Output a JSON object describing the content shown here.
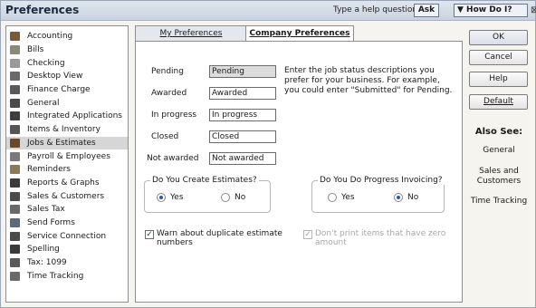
{
  "window": {
    "title": "Preferences"
  },
  "helpbar": {
    "question": "Type a help question",
    "ask": "Ask",
    "howdoi": "▼ How Do I?",
    "close": "⊠"
  },
  "sidebar": {
    "items": [
      {
        "label": "Accounting",
        "icon": "accounting-icon",
        "color": "#7a5a3a"
      },
      {
        "label": "Bills",
        "icon": "bills-icon",
        "color": "#8a8a7a"
      },
      {
        "label": "Checking",
        "icon": "checking-icon",
        "color": "#9a9a9a"
      },
      {
        "label": "Desktop View",
        "icon": "desktop-view-icon",
        "color": "#6a6a6a"
      },
      {
        "label": "Finance Charge",
        "icon": "finance-charge-icon",
        "color": "#5a5a5a"
      },
      {
        "label": "General",
        "icon": "general-icon",
        "color": "#4a4a4a"
      },
      {
        "label": "Integrated Applications",
        "icon": "integrated-applications-icon",
        "color": "#3e3e3e"
      },
      {
        "label": "Items & Inventory",
        "icon": "items-inventory-icon",
        "color": "#555555"
      },
      {
        "label": "Jobs & Estimates",
        "icon": "jobs-estimates-icon",
        "color": "#6a4a2a",
        "selected": true
      },
      {
        "label": "Payroll & Employees",
        "icon": "payroll-employees-icon",
        "color": "#7a7a7a"
      },
      {
        "label": "Reminders",
        "icon": "reminders-icon",
        "color": "#8a7a5a"
      },
      {
        "label": "Reports & Graphs",
        "icon": "reports-graphs-icon",
        "color": "#3a3a3a"
      },
      {
        "label": "Sales & Customers",
        "icon": "sales-customers-icon",
        "color": "#4a4a4a"
      },
      {
        "label": "Sales Tax",
        "icon": "sales-tax-icon",
        "color": "#6a6a6a"
      },
      {
        "label": "Send Forms",
        "icon": "send-forms-icon",
        "color": "#5a6a7a"
      },
      {
        "label": "Service Connection",
        "icon": "service-connection-icon",
        "color": "#4a4a4a"
      },
      {
        "label": "Spelling",
        "icon": "spelling-icon",
        "color": "#3a3a3a"
      },
      {
        "label": "Tax: 1099",
        "icon": "tax-1099-icon",
        "color": "#5a5a5a"
      },
      {
        "label": "Time Tracking",
        "icon": "time-tracking-icon",
        "color": "#6a6a6a"
      }
    ]
  },
  "tabs": {
    "my": "My Preferences",
    "company": "Company Preferences"
  },
  "job_status": {
    "fields": [
      {
        "label": "Pending",
        "value": "Pending",
        "highlight": true
      },
      {
        "label": "Awarded",
        "value": "Awarded"
      },
      {
        "label": "In progress",
        "value": "In progress"
      },
      {
        "label": "Closed",
        "value": "Closed"
      },
      {
        "label": "Not awarded",
        "value": "Not awarded"
      }
    ],
    "description": "Enter the job status descriptions you prefer for your business.  For example, you could enter \"Submitted\" for Pending."
  },
  "estimates": {
    "title": "Do You Create Estimates?",
    "yes": "Yes",
    "no": "No",
    "selected": "yes"
  },
  "progress_invoicing": {
    "title": "Do You Do Progress Invoicing?",
    "yes": "Yes",
    "no": "No",
    "selected": "no"
  },
  "warn_duplicate": {
    "label": "Warn about duplicate estimate numbers",
    "checked": true
  },
  "dont_print_zero": {
    "label": "Don't print items that have zero amount",
    "checked": true,
    "disabled": true
  },
  "buttons": {
    "ok": "OK",
    "cancel": "Cancel",
    "help": "Help",
    "default": "Default"
  },
  "also_see": {
    "title": "Also See:",
    "links": [
      "General",
      "Sales and Customers",
      "Time Tracking"
    ]
  }
}
